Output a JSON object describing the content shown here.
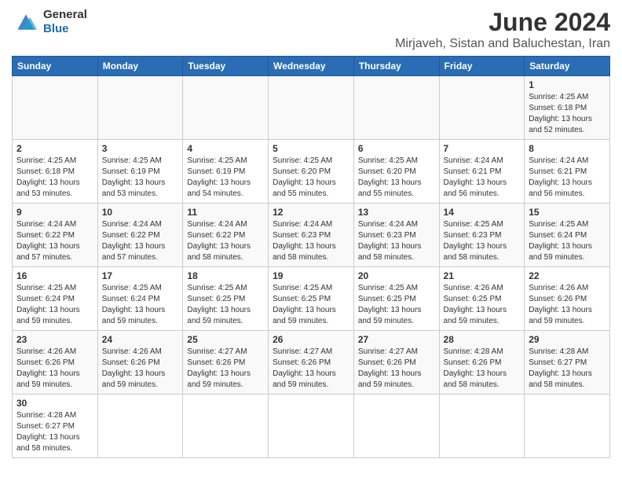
{
  "header": {
    "logo_general": "General",
    "logo_blue": "Blue",
    "title": "June 2024",
    "subtitle": "Mirjaveh, Sistan and Baluchestan, Iran"
  },
  "weekdays": [
    "Sunday",
    "Monday",
    "Tuesday",
    "Wednesday",
    "Thursday",
    "Friday",
    "Saturday"
  ],
  "weeks": [
    [
      {
        "day": "",
        "info": ""
      },
      {
        "day": "",
        "info": ""
      },
      {
        "day": "",
        "info": ""
      },
      {
        "day": "",
        "info": ""
      },
      {
        "day": "",
        "info": ""
      },
      {
        "day": "",
        "info": ""
      },
      {
        "day": "1",
        "info": "Sunrise: 4:25 AM\nSunset: 6:18 PM\nDaylight: 13 hours\nand 52 minutes."
      }
    ],
    [
      {
        "day": "2",
        "info": "Sunrise: 4:25 AM\nSunset: 6:18 PM\nDaylight: 13 hours\nand 53 minutes."
      },
      {
        "day": "3",
        "info": "Sunrise: 4:25 AM\nSunset: 6:19 PM\nDaylight: 13 hours\nand 53 minutes."
      },
      {
        "day": "4",
        "info": "Sunrise: 4:25 AM\nSunset: 6:19 PM\nDaylight: 13 hours\nand 54 minutes."
      },
      {
        "day": "5",
        "info": "Sunrise: 4:25 AM\nSunset: 6:20 PM\nDaylight: 13 hours\nand 55 minutes."
      },
      {
        "day": "6",
        "info": "Sunrise: 4:25 AM\nSunset: 6:20 PM\nDaylight: 13 hours\nand 55 minutes."
      },
      {
        "day": "7",
        "info": "Sunrise: 4:24 AM\nSunset: 6:21 PM\nDaylight: 13 hours\nand 56 minutes."
      },
      {
        "day": "8",
        "info": "Sunrise: 4:24 AM\nSunset: 6:21 PM\nDaylight: 13 hours\nand 56 minutes."
      }
    ],
    [
      {
        "day": "9",
        "info": "Sunrise: 4:24 AM\nSunset: 6:22 PM\nDaylight: 13 hours\nand 57 minutes."
      },
      {
        "day": "10",
        "info": "Sunrise: 4:24 AM\nSunset: 6:22 PM\nDaylight: 13 hours\nand 57 minutes."
      },
      {
        "day": "11",
        "info": "Sunrise: 4:24 AM\nSunset: 6:22 PM\nDaylight: 13 hours\nand 58 minutes."
      },
      {
        "day": "12",
        "info": "Sunrise: 4:24 AM\nSunset: 6:23 PM\nDaylight: 13 hours\nand 58 minutes."
      },
      {
        "day": "13",
        "info": "Sunrise: 4:24 AM\nSunset: 6:23 PM\nDaylight: 13 hours\nand 58 minutes."
      },
      {
        "day": "14",
        "info": "Sunrise: 4:25 AM\nSunset: 6:23 PM\nDaylight: 13 hours\nand 58 minutes."
      },
      {
        "day": "15",
        "info": "Sunrise: 4:25 AM\nSunset: 6:24 PM\nDaylight: 13 hours\nand 59 minutes."
      }
    ],
    [
      {
        "day": "16",
        "info": "Sunrise: 4:25 AM\nSunset: 6:24 PM\nDaylight: 13 hours\nand 59 minutes."
      },
      {
        "day": "17",
        "info": "Sunrise: 4:25 AM\nSunset: 6:24 PM\nDaylight: 13 hours\nand 59 minutes."
      },
      {
        "day": "18",
        "info": "Sunrise: 4:25 AM\nSunset: 6:25 PM\nDaylight: 13 hours\nand 59 minutes."
      },
      {
        "day": "19",
        "info": "Sunrise: 4:25 AM\nSunset: 6:25 PM\nDaylight: 13 hours\nand 59 minutes."
      },
      {
        "day": "20",
        "info": "Sunrise: 4:25 AM\nSunset: 6:25 PM\nDaylight: 13 hours\nand 59 minutes."
      },
      {
        "day": "21",
        "info": "Sunrise: 4:26 AM\nSunset: 6:25 PM\nDaylight: 13 hours\nand 59 minutes."
      },
      {
        "day": "22",
        "info": "Sunrise: 4:26 AM\nSunset: 6:26 PM\nDaylight: 13 hours\nand 59 minutes."
      }
    ],
    [
      {
        "day": "23",
        "info": "Sunrise: 4:26 AM\nSunset: 6:26 PM\nDaylight: 13 hours\nand 59 minutes."
      },
      {
        "day": "24",
        "info": "Sunrise: 4:26 AM\nSunset: 6:26 PM\nDaylight: 13 hours\nand 59 minutes."
      },
      {
        "day": "25",
        "info": "Sunrise: 4:27 AM\nSunset: 6:26 PM\nDaylight: 13 hours\nand 59 minutes."
      },
      {
        "day": "26",
        "info": "Sunrise: 4:27 AM\nSunset: 6:26 PM\nDaylight: 13 hours\nand 59 minutes."
      },
      {
        "day": "27",
        "info": "Sunrise: 4:27 AM\nSunset: 6:26 PM\nDaylight: 13 hours\nand 59 minutes."
      },
      {
        "day": "28",
        "info": "Sunrise: 4:28 AM\nSunset: 6:26 PM\nDaylight: 13 hours\nand 58 minutes."
      },
      {
        "day": "29",
        "info": "Sunrise: 4:28 AM\nSunset: 6:27 PM\nDaylight: 13 hours\nand 58 minutes."
      }
    ],
    [
      {
        "day": "30",
        "info": "Sunrise: 4:28 AM\nSunset: 6:27 PM\nDaylight: 13 hours\nand 58 minutes."
      },
      {
        "day": "",
        "info": ""
      },
      {
        "day": "",
        "info": ""
      },
      {
        "day": "",
        "info": ""
      },
      {
        "day": "",
        "info": ""
      },
      {
        "day": "",
        "info": ""
      },
      {
        "day": "",
        "info": ""
      }
    ]
  ]
}
